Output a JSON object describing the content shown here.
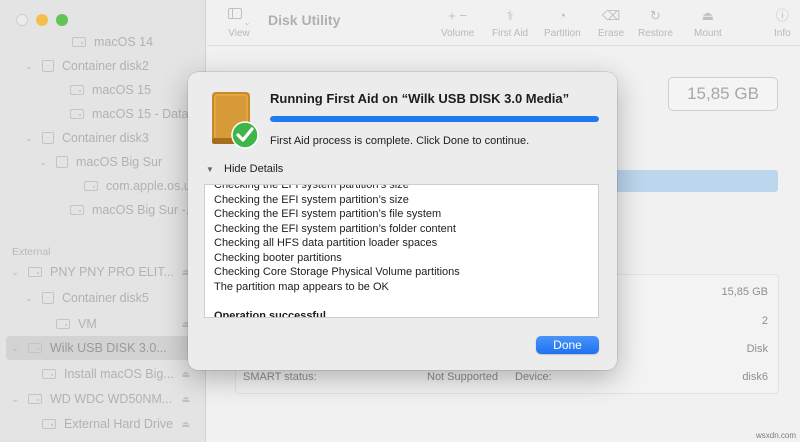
{
  "window": {
    "title": "Disk Utility"
  },
  "toolbar": {
    "view_label": "View",
    "buttons": [
      {
        "label": "Volume",
        "icon": "plus-minus-icon",
        "glyph": "+  −"
      },
      {
        "label": "First Aid",
        "icon": "stethoscope-icon",
        "glyph": "⚕"
      },
      {
        "label": "Partition",
        "icon": "partition-icon",
        "glyph": "◔"
      },
      {
        "label": "Erase",
        "icon": "erase-icon",
        "glyph": "⌫"
      },
      {
        "label": "Restore",
        "icon": "restore-icon",
        "glyph": "↻"
      },
      {
        "label": "Mount",
        "icon": "mount-icon",
        "glyph": "⏏"
      },
      {
        "label": "Info",
        "icon": "info-icon",
        "glyph": "ⓘ"
      }
    ]
  },
  "sidebar": {
    "section_external": "External",
    "items": [
      {
        "label": "macOS 14",
        "type": "disk"
      },
      {
        "label": "Container disk2",
        "type": "container"
      },
      {
        "label": "macOS 15",
        "type": "disk"
      },
      {
        "label": "macOS 15 - Data",
        "type": "disk"
      },
      {
        "label": "Container disk3",
        "type": "container"
      },
      {
        "label": "macOS Big Sur",
        "type": "disk"
      },
      {
        "label": "com.apple.os.u...",
        "type": "disk"
      },
      {
        "label": "macOS Big Sur -...",
        "type": "disk"
      },
      {
        "label": "PNY PNY PRO ELIT...",
        "type": "drive"
      },
      {
        "label": "Container disk5",
        "type": "container"
      },
      {
        "label": "VM",
        "type": "disk"
      },
      {
        "label": "Wilk USB DISK 3.0...",
        "type": "drive"
      },
      {
        "label": "Install macOS Big...",
        "type": "disk"
      },
      {
        "label": "WD WDC WD50NM...",
        "type": "drive"
      },
      {
        "label": "External Hard Drive",
        "type": "disk"
      }
    ]
  },
  "background": {
    "capacity": "15,85 GB",
    "info_values": [
      "15,85 GB",
      "2",
      "Disk"
    ],
    "smart_label": "SMART status:",
    "smart_value": "Not Supported",
    "device_label": "Device:",
    "device_value": "disk6"
  },
  "dialog": {
    "title": "Running First Aid on “Wilk USB DISK 3.0 Media”",
    "progress": 1.0,
    "message": "First Aid process is complete. Click Done to continue.",
    "details_toggle": "Hide Details",
    "log_lines": [
      "Checking the EFI system partition’s size",
      "Checking the EFI system partition’s size",
      "Checking the EFI system partition’s file system",
      "Checking the EFI system partition’s folder content",
      "Checking all HFS data partition loader spaces",
      "Checking booter partitions",
      "Checking Core Storage Physical Volume partitions",
      "The partition map appears to be OK",
      ""
    ],
    "log_result": "Operation successful.",
    "done_label": "Done"
  },
  "watermark": "wsxdn.com",
  "colors": {
    "accent": "#1f7bf0",
    "drive_orange": "#e0a03a",
    "check_green": "#3fb54a"
  }
}
